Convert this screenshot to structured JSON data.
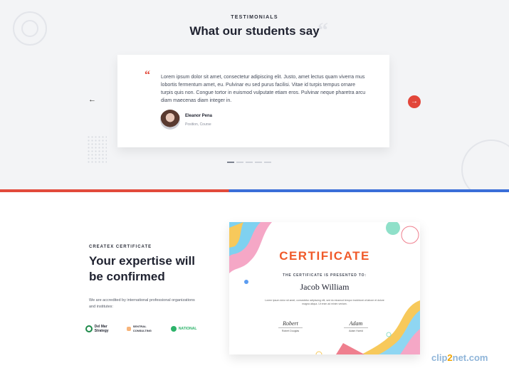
{
  "testimonials": {
    "eyebrow": "TESTIMONIALS",
    "title": "What our students say",
    "quote": "Lorem ipsum dolor sit amet, consectetur adipiscing elit. Justo, amet lectus quam viverra mus lobortis fermentum amet, eu. Pulvinar eu sed purus facilisi. Vitae id turpis tempus ornare turpis quis non. Congue tortor in euismod vulputate etiam eros. Pulvinar neque pharetra arcu diam maecenas diam integer in.",
    "person": {
      "name": "Eleanor Pena",
      "role": "Position, Course"
    },
    "prev_icon": "arrow-left-icon",
    "next_icon": "arrow-right-icon",
    "quote_icon": "quote-icon",
    "dots_count": 5,
    "active_dot": 1
  },
  "certificate_section": {
    "eyebrow": "CREATEX CERTIFICATE",
    "title": "Your expertise will be confirmed",
    "text": "We are accredited by international professional organizations and institutes:",
    "logos": [
      {
        "label": "Del Mar Strategy",
        "icon": "del-mar-logo-icon"
      },
      {
        "label": "SENTRAL CONSULTING",
        "icon": "sentral-logo-icon"
      },
      {
        "label": "NATIONAL",
        "icon": "national-logo-icon"
      }
    ]
  },
  "certificate": {
    "heading": "CERTIFICATE",
    "presented": "THE CERTIFICATE IS PRESENTED TO:",
    "recipient": "Jacob William",
    "body": "Lorem ipsum dolor sit amet, consectetur adipiscing elit, sed do eiusmod tempor incididunt ut labore et dolore magna aliqua. Ut enim ad minim veniam.",
    "signatures": [
      {
        "script": "Robert",
        "name": "Robert Douglas"
      },
      {
        "script": "Adam",
        "name": "Adam Harrid"
      }
    ]
  },
  "watermark": {
    "prefix": "clip",
    "mid": "2",
    "suffix": "net.com"
  },
  "colors": {
    "accent": "#e24a3b",
    "blue": "#3a6ed8",
    "bg": "#f3f4f6"
  }
}
